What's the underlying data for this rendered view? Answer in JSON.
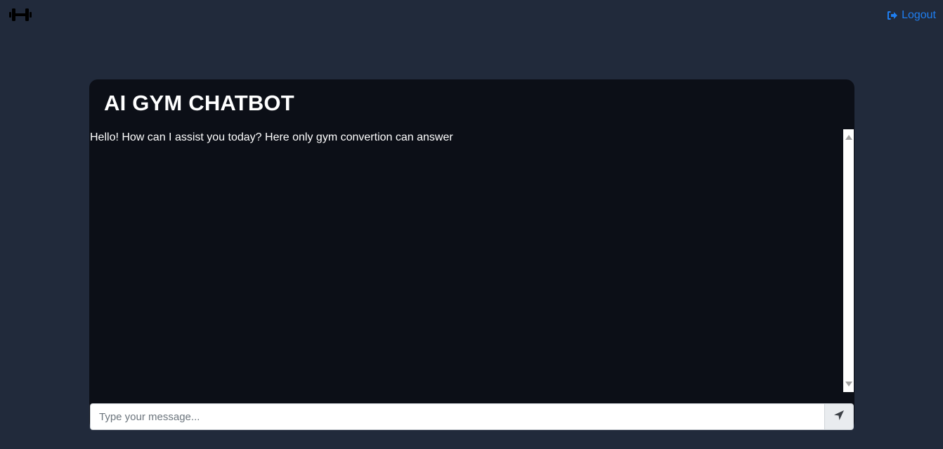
{
  "header": {
    "logo_icon": "dumbbell-icon",
    "logout_label": "Logout",
    "logout_icon": "sign-out-icon",
    "link_color": "#1f7ef0"
  },
  "chat": {
    "title": "AI GYM CHATBOT",
    "messages": [
      {
        "sender": "bot",
        "text": "Hello! How can I assist you today? Here only gym convertion can answer"
      }
    ],
    "input": {
      "placeholder": "Type your message...",
      "value": ""
    },
    "send_icon": "paper-plane-icon"
  },
  "colors": {
    "page_background": "#212a3b",
    "card_background": "#0c0f17"
  }
}
